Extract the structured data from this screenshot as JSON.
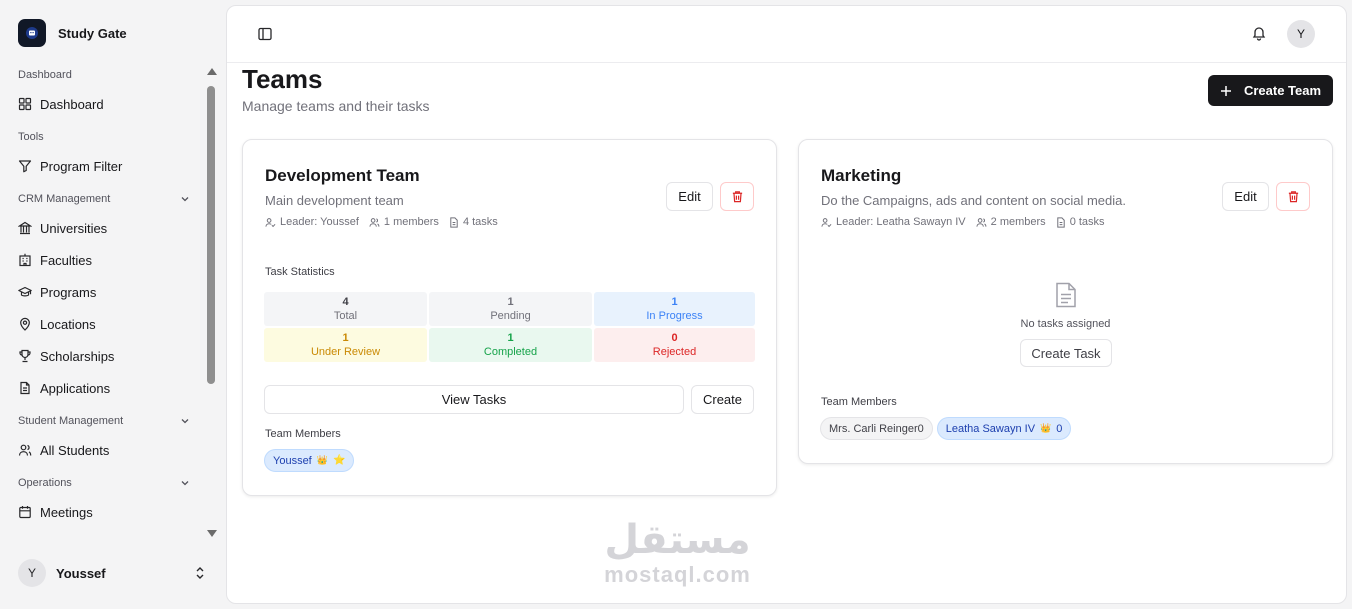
{
  "app": {
    "brand": "Study Gate",
    "user_name": "Youssef",
    "user_initial": "Y"
  },
  "sidebar": {
    "sections": [
      {
        "title": "Dashboard",
        "items": [
          {
            "label": "Dashboard",
            "icon": "grid-icon"
          }
        ]
      },
      {
        "title": "Tools",
        "items": [
          {
            "label": "Program Filter",
            "icon": "filter-icon"
          }
        ]
      },
      {
        "title": "CRM Management",
        "items": [
          {
            "label": "Universities",
            "icon": "library-icon"
          },
          {
            "label": "Faculties",
            "icon": "building-icon"
          },
          {
            "label": "Programs",
            "icon": "graduation-cap-icon"
          },
          {
            "label": "Locations",
            "icon": "map-pin-icon"
          },
          {
            "label": "Scholarships",
            "icon": "trophy-icon"
          },
          {
            "label": "Applications",
            "icon": "file-text-icon"
          }
        ]
      },
      {
        "title": "Student Management",
        "items": [
          {
            "label": "All Students",
            "icon": "users-icon"
          }
        ]
      },
      {
        "title": "Operations",
        "items": [
          {
            "label": "Meetings",
            "icon": "calendar-icon"
          }
        ]
      }
    ]
  },
  "header": {
    "avatar_initial": "Y"
  },
  "page": {
    "title": "Teams",
    "subtitle": "Manage teams and their tasks",
    "create_team_label": "Create Team"
  },
  "teams": [
    {
      "name": "Development Team",
      "description": "Main development team",
      "leader": "Leader: Youssef",
      "members_count": "1 members",
      "tasks_count": "4 tasks",
      "edit_label": "Edit",
      "stats_title": "Task Statistics",
      "stats": [
        {
          "value": "4",
          "label": "Total"
        },
        {
          "value": "1",
          "label": "Pending"
        },
        {
          "value": "1",
          "label": "In Progress"
        },
        {
          "value": "1",
          "label": "Under Review"
        },
        {
          "value": "1",
          "label": "Completed"
        },
        {
          "value": "0",
          "label": "Rejected"
        }
      ],
      "view_tasks_label": "View Tasks",
      "create_label": "Create",
      "members_title": "Team Members",
      "members": [
        {
          "name": "Youssef",
          "crown": "👑",
          "star": "⭐"
        }
      ]
    },
    {
      "name": "Marketing",
      "description": "Do the Campaigns, ads and content on social media.",
      "leader": "Leader: Leatha Sawayn IV",
      "members_count": "2 members",
      "tasks_count": "0 tasks",
      "edit_label": "Edit",
      "empty_text": "No tasks assigned",
      "create_task_label": "Create Task",
      "members_title": "Team Members",
      "members": [
        {
          "name": "Mrs. Carli Reinger0"
        },
        {
          "name": "Leatha Sawayn IV",
          "crown": "👑",
          "suffix": "0"
        }
      ]
    }
  ],
  "colors": {
    "primary": "#18181b",
    "danger": "#dc2626",
    "stat_total_bg": "#f4f5f7",
    "stat_progress_bg": "#e8f2fd",
    "stat_review_bg": "#fdfbe0",
    "stat_completed_bg": "#e9f8ef",
    "stat_rejected_bg": "#fdeeee"
  },
  "watermark": {
    "arabic": "مستقل",
    "latin": "mostaql.com"
  }
}
